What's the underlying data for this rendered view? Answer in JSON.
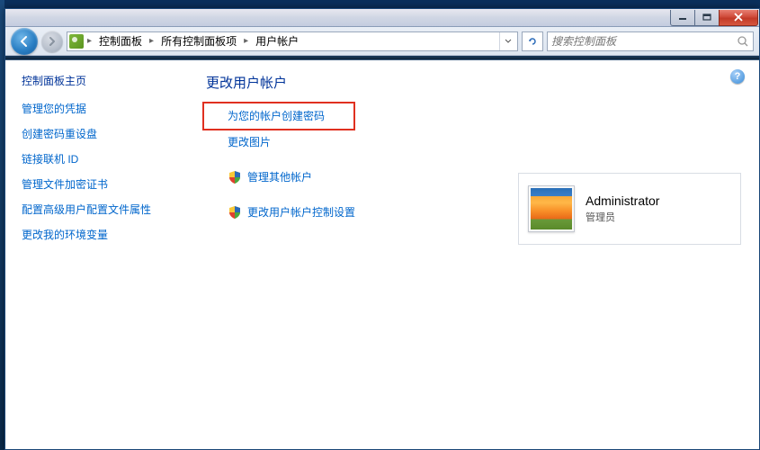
{
  "breadcrumbs": {
    "item1": "控制面板",
    "item2": "所有控制面板项",
    "item3": "用户帐户"
  },
  "search": {
    "placeholder": "搜索控制面板"
  },
  "sidebar": {
    "title": "控制面板主页",
    "links": {
      "l0": "管理您的凭据",
      "l1": "创建密码重设盘",
      "l2": "链接联机 ID",
      "l3": "管理文件加密证书",
      "l4": "配置高级用户配置文件属性",
      "l5": "更改我的环境变量"
    }
  },
  "main": {
    "title": "更改用户帐户",
    "tasks": {
      "t0": "为您的帐户创建密码",
      "t1": "更改图片",
      "t2": "管理其他帐户",
      "t3": "更改用户帐户控制设置"
    }
  },
  "account": {
    "name": "Administrator",
    "role": "管理员"
  },
  "help": {
    "symbol": "?"
  }
}
